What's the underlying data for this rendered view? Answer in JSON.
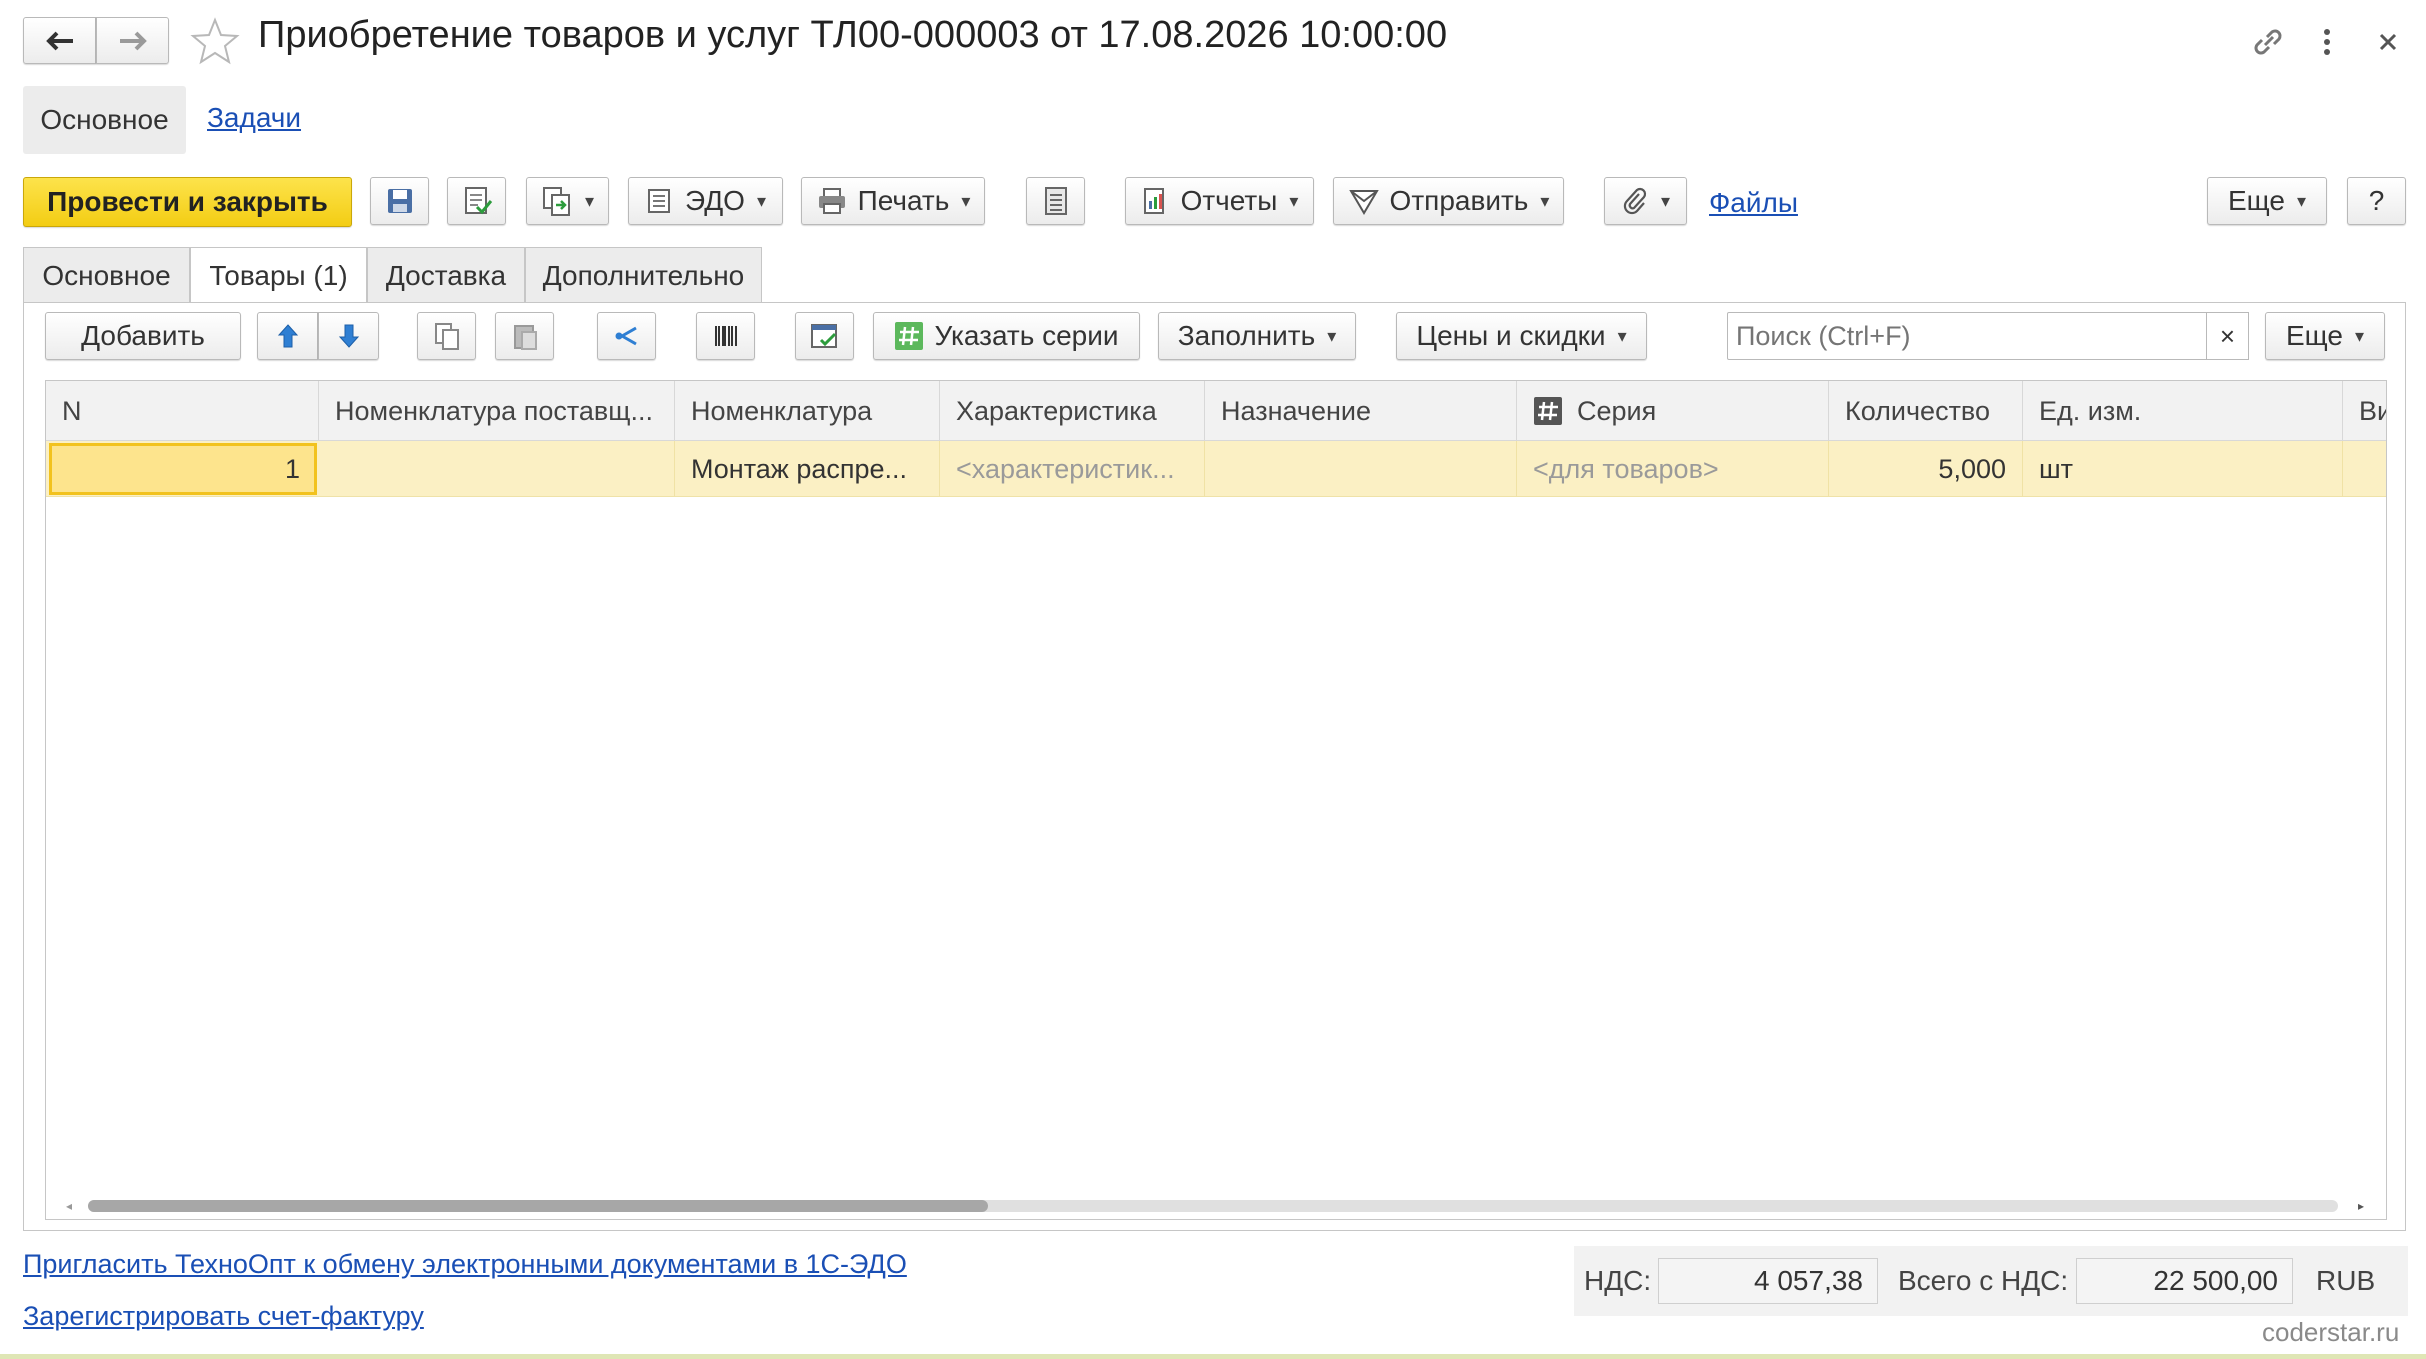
{
  "window": {
    "title": "Приобретение товаров и услуг ТЛ00-000003 от 17.08.2026 10:00:00"
  },
  "topnav": {
    "main": "Основное",
    "tasks": "Задачи"
  },
  "toolbar": {
    "post_close": "Провести и закрыть",
    "edo": "ЭДО",
    "print": "Печать",
    "reports": "Отчеты",
    "send": "Отправить",
    "files": "Файлы",
    "more": "Еще",
    "help": "?"
  },
  "tabs": [
    "Основное",
    "Товары (1)",
    "Доставка",
    "Дополнительно"
  ],
  "goods_toolbar": {
    "add": "Добавить",
    "series": "Указать серии",
    "fill": "Заполнить",
    "prices": "Цены и скидки",
    "search_placeholder": "Поиск (Ctrl+F)",
    "clear": "×",
    "more": "Еще"
  },
  "table": {
    "columns": [
      "N",
      "Номенклатура поставщ...",
      "Номенклатура",
      "Характеристика",
      "Назначение",
      "Серия",
      "Количество",
      "Ед. изм.",
      "Ви"
    ],
    "rows": [
      {
        "n": "1",
        "supplier_item": "",
        "item": "Монтаж распре...",
        "characteristic": "<характеристик...",
        "purpose": "",
        "series": "<для товаров>",
        "quantity": "5,000",
        "unit": "шт"
      }
    ]
  },
  "footer": {
    "invite_link": "Пригласить ТехноОпт к обмену электронными документами в 1С-ЭДО",
    "register_link": "Зарегистрировать счет-фактуру",
    "vat_label": "НДС:",
    "vat_value": "4 057,38",
    "total_label": "Всего с НДС:",
    "total_value": "22 500,00",
    "currency": "RUB",
    "watermark": "coderstar.ru"
  },
  "colors": {
    "accent_yellow": "#f5d21c",
    "selected_row": "#fbf0c4",
    "link": "#1a4fb5"
  }
}
